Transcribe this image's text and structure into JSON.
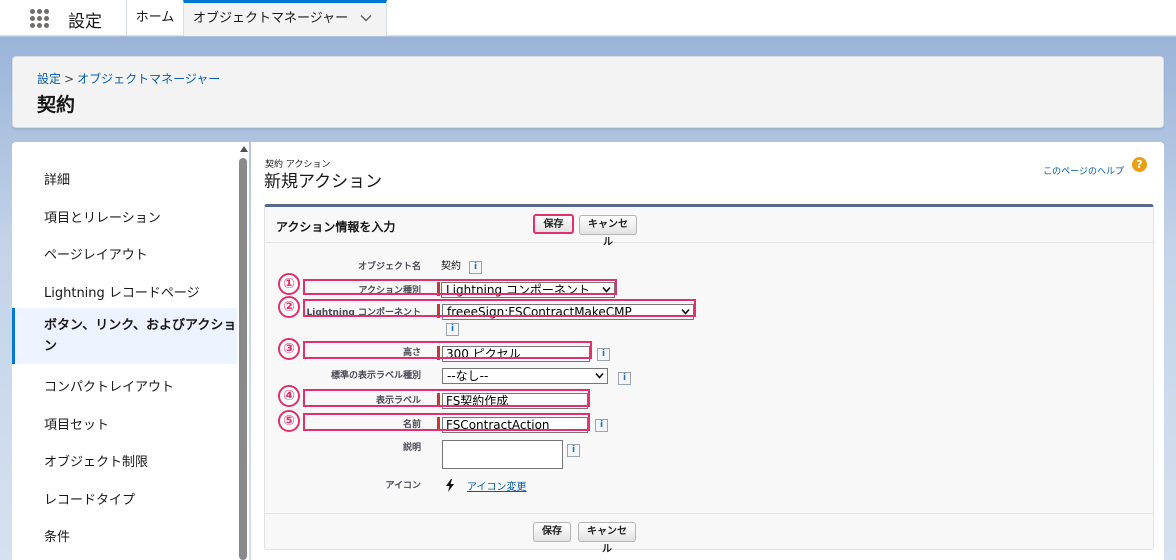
{
  "topbar": {
    "app_name": "設定",
    "nav_home": "ホーム",
    "nav_tab": "オブジェクトマネージャー"
  },
  "header": {
    "breadcrumb_root": "設定",
    "breadcrumb_sep": ">",
    "breadcrumb_current": "オブジェクトマネージャー",
    "object_title": "契約"
  },
  "sidebar": {
    "items": [
      {
        "label": "詳細"
      },
      {
        "label": "項目とリレーション"
      },
      {
        "label": "ページレイアウト"
      },
      {
        "label": "Lightning レコードページ"
      },
      {
        "label": "ボタン、リンク、およびアクション",
        "active": true
      },
      {
        "label": "コンパクトレイアウト"
      },
      {
        "label": "項目セット"
      },
      {
        "label": "オブジェクト制限"
      },
      {
        "label": "レコードタイプ"
      },
      {
        "label": "条件"
      }
    ]
  },
  "page": {
    "subtitle": "契約 アクション",
    "title": "新規アクション",
    "help_link": "このページのヘルプ",
    "help_icon": "?"
  },
  "form": {
    "section_title": "アクション情報を入力",
    "save_label": "保存",
    "cancel_label": "キャンセル",
    "info_glyph": "i",
    "object_name_label": "オブジェクト名",
    "object_name_value": "契約",
    "action_type_label": "アクション種別",
    "action_type_value": "Lightning コンポーネント",
    "lightning_component_label": "Lightning コンポーネント",
    "lightning_component_value": "freeeSign:FSContractMakeCMP",
    "height_label": "高さ",
    "height_value": "300 ピクセル",
    "standard_label_type_label": "標準の表示ラベル種別",
    "standard_label_type_value": "--なし--",
    "display_label_label": "表示ラベル",
    "display_label_value": "FS契約作成",
    "name_label": "名前",
    "name_value": "FSContractAction",
    "description_label": "説明",
    "description_value": "",
    "icon_label": "アイコン",
    "icon_change_link": "アイコン変更"
  },
  "annotations": [
    "①",
    "②",
    "③",
    "④",
    "⑤"
  ],
  "colors": {
    "highlight": "#e0306e",
    "link": "#015ba7",
    "brand": "#0176d3",
    "required": "#c23934"
  }
}
